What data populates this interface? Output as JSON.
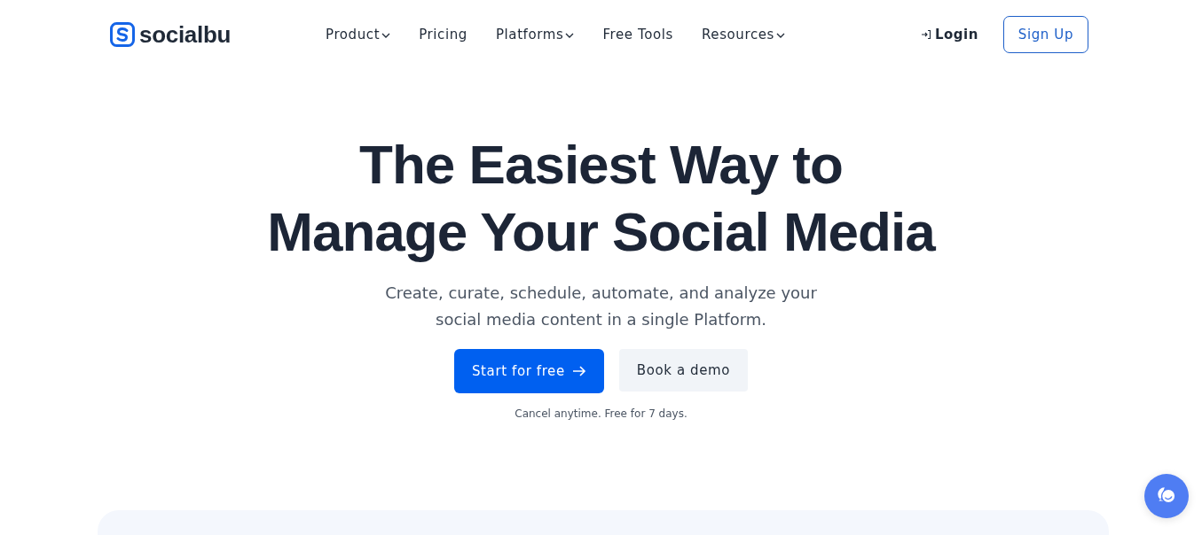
{
  "logo": {
    "text": "socialbu"
  },
  "nav": [
    {
      "label": "Product",
      "has_menu": true
    },
    {
      "label": "Pricing",
      "has_menu": false
    },
    {
      "label": "Platforms",
      "has_menu": true
    },
    {
      "label": "Free Tools",
      "has_menu": false
    },
    {
      "label": "Resources",
      "has_menu": true
    }
  ],
  "login": "Login",
  "signup": "Sign Up",
  "hero": {
    "title_lines": [
      "The Easiest Way to",
      "Manage Your Social Media"
    ],
    "subtitle_lines": [
      "Create, curate, schedule, automate, and analyze your",
      "social media content in a single Platform."
    ],
    "primary_button": "Start for free",
    "secondary_button": "Book a demo",
    "note": "Cancel anytime. Free for 7 days."
  }
}
